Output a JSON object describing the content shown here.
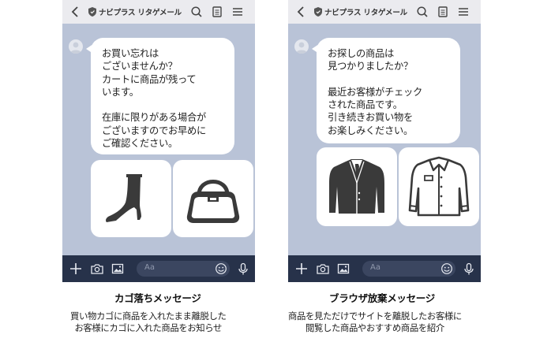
{
  "left": {
    "app_title": "ナビプラス リタゲメール",
    "message": "お買い忘れは\nございませんか？\nカートに商品が残って\nいます。\n\n在庫に限りがある場合が\nございますのでお早めに\nご確認ください。",
    "products": [
      "boot-icon",
      "handbag-icon"
    ],
    "input_placeholder": "Aa",
    "caption_title": "カゴ落ちメッセージ",
    "caption_desc": "買い物カゴに商品を入れたまま離脱した\nお客様にカゴに入れた商品をお知らせ"
  },
  "right": {
    "app_title": "ナビプラス リタゲメール",
    "message": "お探しの商品は\n見つかりましたか？\n\n最近お客様がチェック\nされた商品です。\n引き続きお買い物を\nお楽しみください。",
    "products": [
      "suit-jacket-icon",
      "dress-shirt-icon"
    ],
    "input_placeholder": "Aa",
    "caption_title": "ブラウザ放棄メッセージ",
    "caption_desc": "商品を見ただけでサイトを離脱したお客様に\n閲覧した商品やおすすめ商品を紹介"
  },
  "colors": {
    "chat_background": "#b9c3d7",
    "header_background": "#ebebef",
    "input_bar": "#27324a",
    "bubble": "#ffffff",
    "product_icon": "#3a3a3a"
  }
}
